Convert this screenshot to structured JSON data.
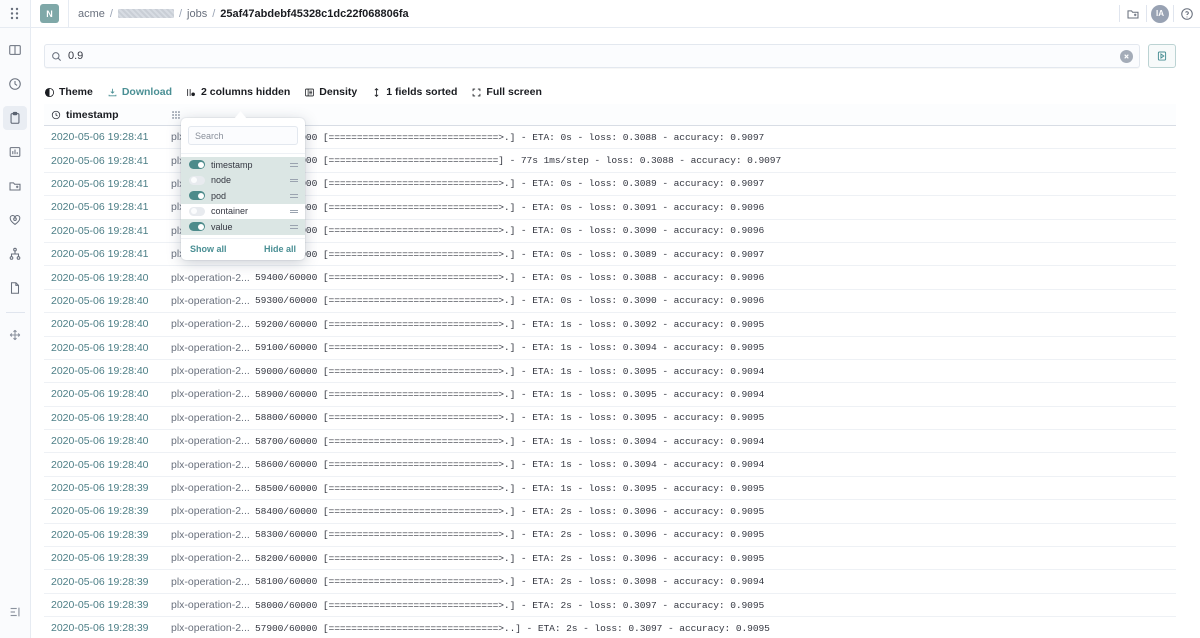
{
  "header": {
    "brand_initial": "N",
    "breadcrumb": [
      {
        "label": "acme",
        "type": "link"
      },
      {
        "label": "",
        "type": "redacted"
      },
      {
        "label": "jobs",
        "type": "link"
      },
      {
        "label": "25af47abdebf45328c1dc22f068806fa",
        "type": "current"
      }
    ],
    "separator": "/",
    "folder_icon": "folder-add-icon",
    "avatar_initials": "IA",
    "help_icon": "question-circle-icon"
  },
  "rail": {
    "grip_icon": "grip-dots-icon",
    "items": [
      {
        "icon": "book-open-icon",
        "active": false
      },
      {
        "icon": "clock-icon",
        "active": false
      },
      {
        "icon": "clipboard-icon",
        "active": true
      },
      {
        "icon": "chart-bar-icon",
        "active": false
      },
      {
        "icon": "folder-add-icon",
        "active": false
      },
      {
        "icon": "heart-gear-icon",
        "active": false
      },
      {
        "icon": "sitemap-icon",
        "active": false
      },
      {
        "icon": "document-icon",
        "active": false
      },
      {
        "icon": "move-arrows-icon",
        "active": false
      }
    ],
    "bottom_icon": "collapse-panel-icon"
  },
  "search": {
    "icon": "search-icon",
    "value": "0.9",
    "placeholder": "Search",
    "clear_icon": "clear-circle-icon",
    "run_icon": "play-icon"
  },
  "toolbar": [
    {
      "label": "Theme",
      "icon": "contrast-icon",
      "style": "bold"
    },
    {
      "label": "Download",
      "icon": "download-icon",
      "style": "link"
    },
    {
      "label": "2 columns hidden",
      "icon": "columns-icon",
      "style": "bold"
    },
    {
      "label": "Density",
      "icon": "density-icon",
      "style": "bold"
    },
    {
      "label": "1 fields sorted",
      "icon": "sort-icon",
      "style": "bold"
    },
    {
      "label": "Full screen",
      "icon": "fullscreen-icon",
      "style": "bold"
    }
  ],
  "columns_popover": {
    "search_placeholder": "Search",
    "fields": [
      {
        "label": "timestamp",
        "visible": true,
        "highlighted": true
      },
      {
        "label": "node",
        "visible": false,
        "highlighted": true
      },
      {
        "label": "pod",
        "visible": true,
        "highlighted": true
      },
      {
        "label": "container",
        "visible": false,
        "highlighted": false
      },
      {
        "label": "value",
        "visible": true,
        "highlighted": true
      }
    ],
    "show_all_label": "Show all",
    "hide_all_label": "Hide all"
  },
  "table": {
    "columns": [
      {
        "label": "timestamp",
        "icon": "clock-icon"
      },
      {
        "label": "",
        "icon": "grid-icon"
      }
    ],
    "rows": [
      {
        "timestamp": "2020-05-06 19:28:41",
        "pod": "plx-operation-2...",
        "value": "59900/60000 [==============================>.] - ETA: 0s - loss: 0.3088 - accuracy: 0.9097"
      },
      {
        "timestamp": "2020-05-06 19:28:41",
        "pod": "plx-operation-2...",
        "value": "60000/60000 [==============================] - 77s 1ms/step - loss: 0.3088 - accuracy: 0.9097"
      },
      {
        "timestamp": "2020-05-06 19:28:41",
        "pod": "plx-operation-2...",
        "value": "59800/60000 [==============================>.] - ETA: 0s - loss: 0.3089 - accuracy: 0.9097"
      },
      {
        "timestamp": "2020-05-06 19:28:41",
        "pod": "plx-operation-2...",
        "value": "59700/60000 [==============================>.] - ETA: 0s - loss: 0.3091 - accuracy: 0.9096"
      },
      {
        "timestamp": "2020-05-06 19:28:41",
        "pod": "plx-operation-2...",
        "value": "59600/60000 [==============================>.] - ETA: 0s - loss: 0.3090 - accuracy: 0.9096"
      },
      {
        "timestamp": "2020-05-06 19:28:41",
        "pod": "plx-operation-2...",
        "value": "59500/60000 [==============================>.] - ETA: 0s - loss: 0.3089 - accuracy: 0.9097"
      },
      {
        "timestamp": "2020-05-06 19:28:40",
        "pod": "plx-operation-2...",
        "value": "59400/60000 [==============================>.] - ETA: 0s - loss: 0.3088 - accuracy: 0.9096"
      },
      {
        "timestamp": "2020-05-06 19:28:40",
        "pod": "plx-operation-2...",
        "value": "59300/60000 [==============================>.] - ETA: 0s - loss: 0.3090 - accuracy: 0.9096"
      },
      {
        "timestamp": "2020-05-06 19:28:40",
        "pod": "plx-operation-2...",
        "value": "59200/60000 [==============================>.] - ETA: 1s - loss: 0.3092 - accuracy: 0.9095"
      },
      {
        "timestamp": "2020-05-06 19:28:40",
        "pod": "plx-operation-2...",
        "value": "59100/60000 [==============================>.] - ETA: 1s - loss: 0.3094 - accuracy: 0.9095"
      },
      {
        "timestamp": "2020-05-06 19:28:40",
        "pod": "plx-operation-2...",
        "value": "59000/60000 [==============================>.] - ETA: 1s - loss: 0.3095 - accuracy: 0.9094"
      },
      {
        "timestamp": "2020-05-06 19:28:40",
        "pod": "plx-operation-2...",
        "value": "58900/60000 [==============================>.] - ETA: 1s - loss: 0.3095 - accuracy: 0.9094"
      },
      {
        "timestamp": "2020-05-06 19:28:40",
        "pod": "plx-operation-2...",
        "value": "58800/60000 [==============================>.] - ETA: 1s - loss: 0.3095 - accuracy: 0.9095"
      },
      {
        "timestamp": "2020-05-06 19:28:40",
        "pod": "plx-operation-2...",
        "value": "58700/60000 [==============================>.] - ETA: 1s - loss: 0.3094 - accuracy: 0.9094"
      },
      {
        "timestamp": "2020-05-06 19:28:40",
        "pod": "plx-operation-2...",
        "value": "58600/60000 [==============================>.] - ETA: 1s - loss: 0.3094 - accuracy: 0.9094"
      },
      {
        "timestamp": "2020-05-06 19:28:39",
        "pod": "plx-operation-2...",
        "value": "58500/60000 [==============================>.] - ETA: 1s - loss: 0.3095 - accuracy: 0.9095"
      },
      {
        "timestamp": "2020-05-06 19:28:39",
        "pod": "plx-operation-2...",
        "value": "58400/60000 [==============================>.] - ETA: 2s - loss: 0.3096 - accuracy: 0.9095"
      },
      {
        "timestamp": "2020-05-06 19:28:39",
        "pod": "plx-operation-2...",
        "value": "58300/60000 [==============================>.] - ETA: 2s - loss: 0.3096 - accuracy: 0.9095"
      },
      {
        "timestamp": "2020-05-06 19:28:39",
        "pod": "plx-operation-2...",
        "value": "58200/60000 [==============================>.] - ETA: 2s - loss: 0.3096 - accuracy: 0.9095"
      },
      {
        "timestamp": "2020-05-06 19:28:39",
        "pod": "plx-operation-2...",
        "value": "58100/60000 [==============================>.] - ETA: 2s - loss: 0.3098 - accuracy: 0.9094"
      },
      {
        "timestamp": "2020-05-06 19:28:39",
        "pod": "plx-operation-2...",
        "value": "58000/60000 [==============================>.] - ETA: 2s - loss: 0.3097 - accuracy: 0.9095"
      },
      {
        "timestamp": "2020-05-06 19:28:39",
        "pod": "plx-operation-2...",
        "value": "57900/60000 [==============================>..] - ETA: 2s - loss: 0.3097 - accuracy: 0.9095"
      }
    ]
  },
  "colors": {
    "accent": "#4a8f94",
    "link": "#4c7e86",
    "toggle_on": "#4d8b8b",
    "border": "#e6ebf2"
  }
}
